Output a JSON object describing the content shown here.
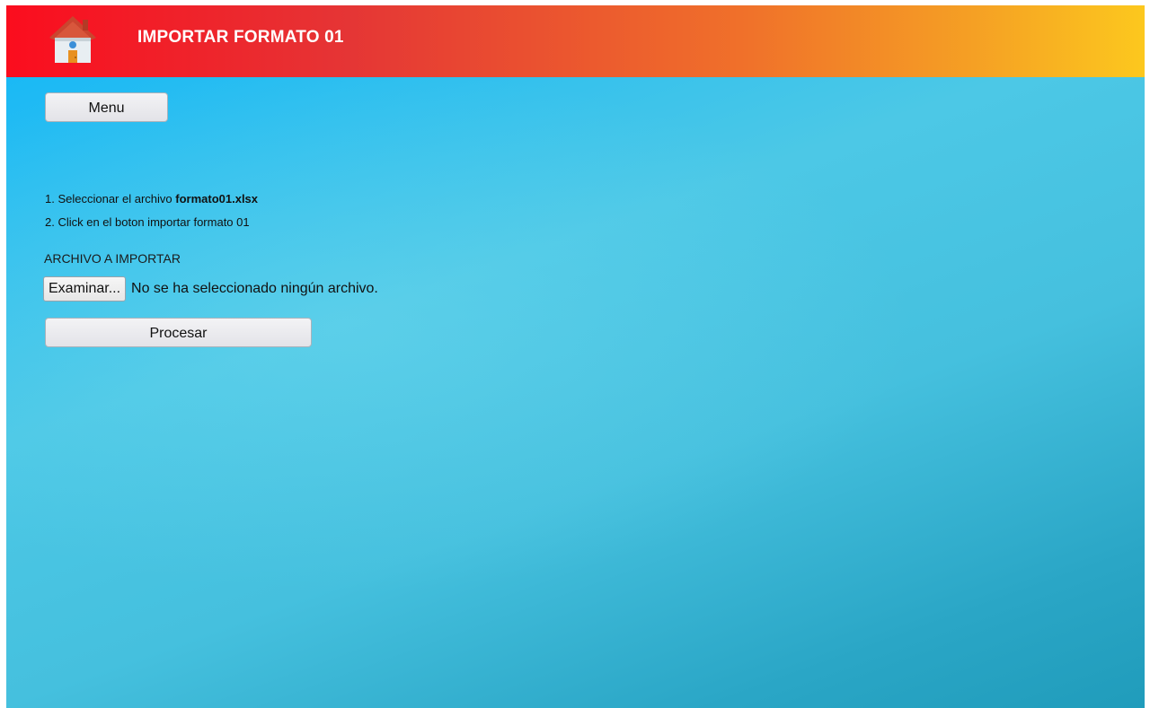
{
  "header": {
    "title": "IMPORTAR FORMATO 01",
    "home_icon": "home-icon",
    "gradient_colors": [
      "#fb0d1e",
      "#f0712a",
      "#fcc81e"
    ]
  },
  "nav": {
    "menu_label": "Menu"
  },
  "instructions": {
    "step1_prefix": "1. Seleccionar el archivo ",
    "step1_file": "formato01.xlsx",
    "step2": "2. Click en el boton importar formato 01"
  },
  "file_upload": {
    "label": "ARCHIVO A IMPORTAR",
    "browse_label": "Examinar...",
    "status": "No se ha seleccionado ningún archivo."
  },
  "actions": {
    "process_label": "Procesar"
  },
  "colors": {
    "background_primary": "#1ab9f5",
    "background_secondary": "#209cbb"
  }
}
